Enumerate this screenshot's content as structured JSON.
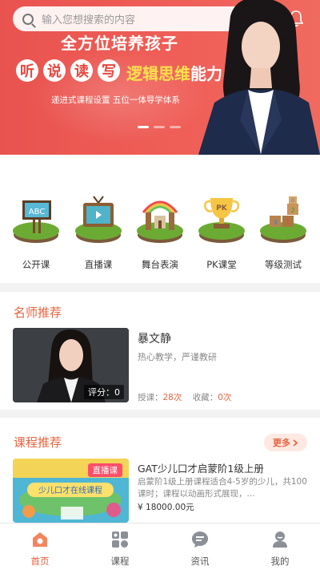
{
  "search": {
    "placeholder": "输入您想搜索的内容"
  },
  "banner": {
    "title": "全方位培养孩子",
    "skills": [
      "听",
      "说",
      "读",
      "写"
    ],
    "highlight": "逻辑思维",
    "highlight_suffix": "能力",
    "subtitle": "递进式课程设置  五位一体导学体系",
    "slide_count": 3,
    "active_slide": 0
  },
  "categories": [
    {
      "label": "公开课",
      "icon": "abc-board-icon"
    },
    {
      "label": "直播课",
      "icon": "tv-icon"
    },
    {
      "label": "舞台表演",
      "icon": "stage-icon"
    },
    {
      "label": "PK课堂",
      "icon": "trophy-icon"
    },
    {
      "label": "等级测试",
      "icon": "blocks-icon"
    }
  ],
  "teachers": {
    "title": "名师推荐",
    "item": {
      "name": "暴文静",
      "desc": "热心教学，严谨教研",
      "score_label": "评分：0",
      "lessons_label": "授课：",
      "lessons_value": "28次",
      "favorites_label": "收藏：",
      "favorites_value": "0次"
    }
  },
  "courses": {
    "title": "课程推荐",
    "more": "更多",
    "item": {
      "tag": "直播课",
      "image_text": "少儿口才在线课程",
      "name": "GAT少儿口才启蒙阶1级上册",
      "desc": "启蒙阶1级上册课程适合4-5岁的少儿，共100课时；课程以动画形式展现，...",
      "price": "¥ 18000.00元"
    }
  },
  "tabbar": [
    {
      "label": "首页",
      "icon": "home-icon",
      "active": true
    },
    {
      "label": "课程",
      "icon": "course-grid-icon",
      "active": false
    },
    {
      "label": "资讯",
      "icon": "news-icon",
      "active": false
    },
    {
      "label": "我的",
      "icon": "user-icon",
      "active": false
    }
  ],
  "colors": {
    "accent": "#e8633f",
    "banner": "#ee5a53",
    "tag": "#ff4e6a"
  }
}
